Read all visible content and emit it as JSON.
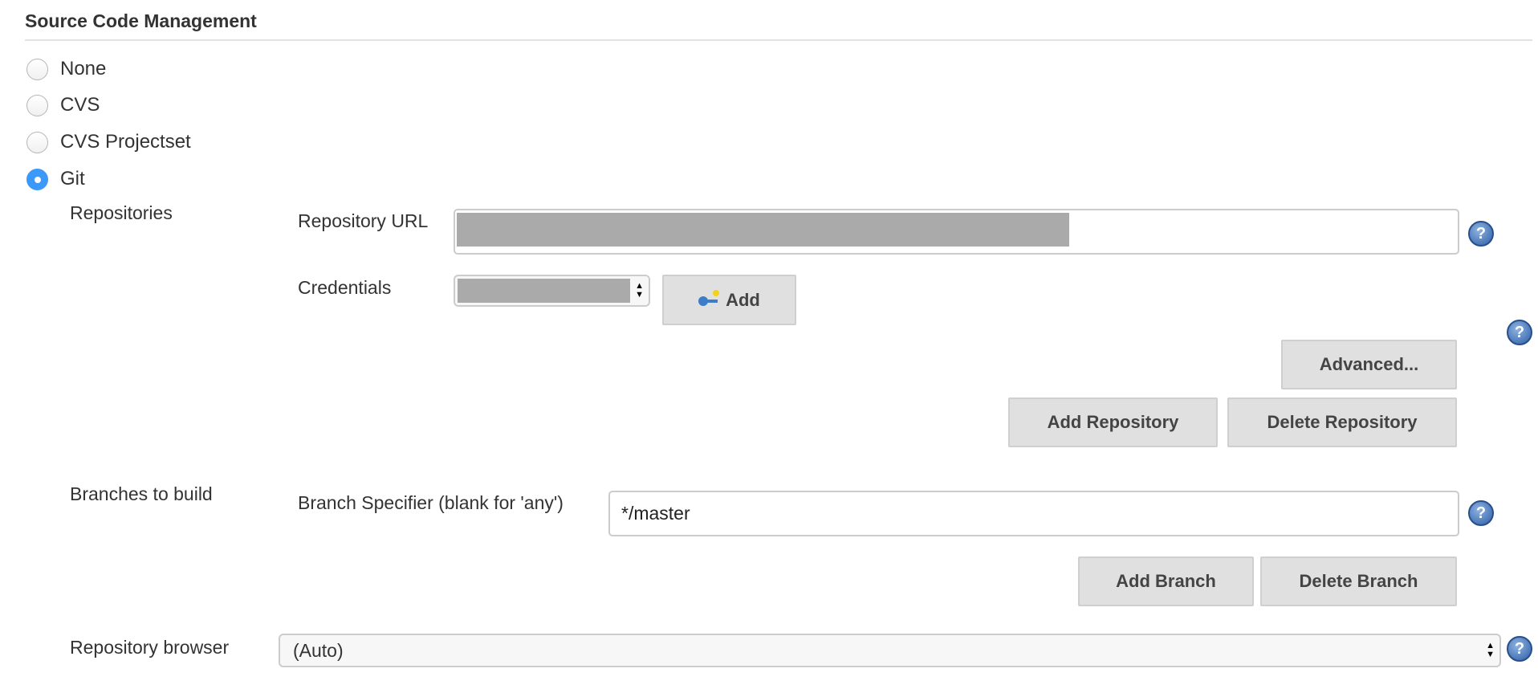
{
  "section": {
    "title": "Source Code Management"
  },
  "scm_options": [
    {
      "label": "None",
      "selected": false
    },
    {
      "label": "CVS",
      "selected": false
    },
    {
      "label": "CVS Projectset",
      "selected": false
    },
    {
      "label": "Git",
      "selected": true
    }
  ],
  "git": {
    "repositories_label": "Repositories",
    "repo_url_label": "Repository URL",
    "credentials_label": "Credentials",
    "add_credentials_label": "Add",
    "advanced_label": "Advanced...",
    "add_repository_label": "Add Repository",
    "delete_repository_label": "Delete Repository",
    "branches_label": "Branches to build",
    "branch_specifier_label": "Branch Specifier (blank for 'any')",
    "branch_specifier_value": "*/master",
    "add_branch_label": "Add Branch",
    "delete_branch_label": "Delete Branch",
    "repo_browser_label": "Repository browser",
    "repo_browser_value": "(Auto)"
  },
  "icons": {
    "help": "?",
    "key": "key-icon"
  },
  "colors": {
    "radio_selected": "#3b99fc",
    "button_bg": "#e0e0e0",
    "help_blue": "#2e5ea6",
    "redaction": "#aaaaaa"
  }
}
